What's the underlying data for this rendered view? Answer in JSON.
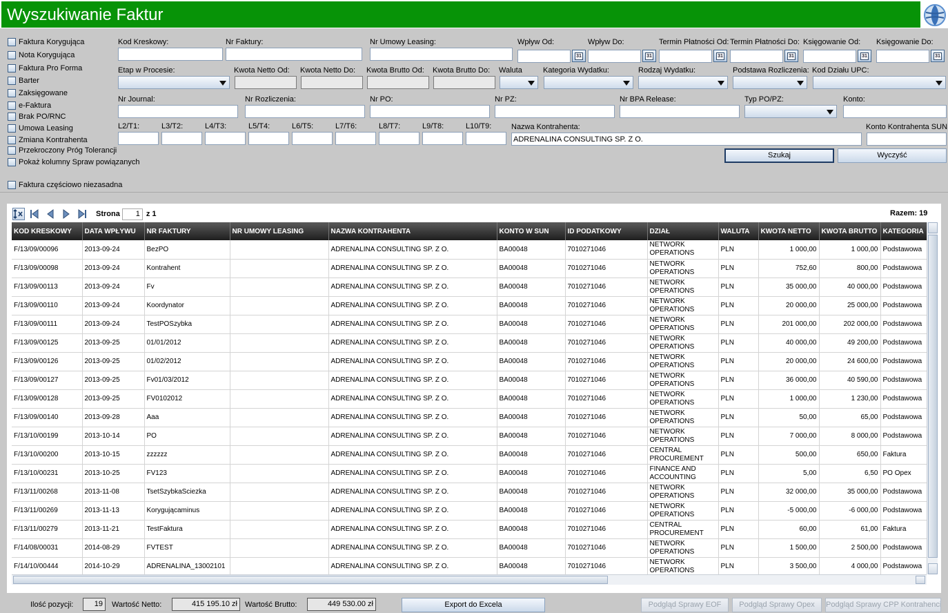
{
  "window": {
    "title": "Wyszukiwanie Faktur"
  },
  "checkboxes": [
    "Faktura Korygująca",
    "Nota Korygująca",
    "Faktura Pro Forma",
    "Barter",
    "Zaksięgowane",
    "e-Faktura",
    "Brak PO/RNC",
    "Umowa Leasing",
    "Zmiana Kontrahenta",
    "Przekroczony Próg Tolerancji",
    "Pokaż kolumny Spraw powiązanych",
    "Faktura częściowo niezasadna"
  ],
  "filters": {
    "kod_kreskowy": "Kod Kreskowy:",
    "nr_faktury": "Nr Faktury:",
    "nr_umowy_leasing": "Nr Umowy Leasing:",
    "wplyw_od": "Wpływ Od:",
    "wplyw_do": "Wpływ Do:",
    "termin_od": "Termin Płatności Od:",
    "termin_do": "Termin Płatności Do:",
    "ksiegowanie_od": "Księgowanie Od:",
    "ksiegowanie_do": "Księgowanie Do:",
    "etap": "Etap w Procesie:",
    "kwota_netto_od": "Kwota Netto Od:",
    "kwota_netto_do": "Kwota Netto Do:",
    "kwota_brutto_od": "Kwota Brutto Od:",
    "kwota_brutto_do": "Kwota Brutto Do:",
    "waluta": "Waluta",
    "kategoria": "Kategoria Wydatku:",
    "rodzaj": "Rodzaj Wydatku:",
    "podstawa": "Podstawa Rozliczenia:",
    "kod_dzialu": "Kod Działu UPC:",
    "nr_journal": "Nr Journal:",
    "nr_rozliczenia": "Nr Rozliczenia:",
    "nr_po": "Nr PO:",
    "nr_pz": "Nr PZ:",
    "nr_bpa": "Nr BPA Release:",
    "typ_po_pz": "Typ PO/PZ:",
    "konto": "Konto:",
    "l2": "L2/T1:",
    "l3": "L3/T2:",
    "l4": "L4/T3:",
    "l5": "L5/T4:",
    "l6": "L6/T5:",
    "l7": "L7/T6:",
    "l8": "L8/T7:",
    "l9": "L9/T8:",
    "l10": "L10/T9:",
    "nazwa_kontrahenta": "Nazwa Kontrahenta:",
    "nazwa_kontrahenta_value": "ADRENALINA CONSULTING SP. Z O.",
    "konto_sun": "Konto Kontrahenta SUN:",
    "cal_icon_text": "31",
    "search_button": "Szukaj",
    "clear_button": "Wyczyść"
  },
  "pager": {
    "strona_label": "Strona",
    "page": "1",
    "of": "z 1",
    "razem": "Razem: 19"
  },
  "table": {
    "columns": [
      "KOD KRESKOWY",
      "DATA WPŁYWU",
      "NR FAKTURY",
      "NR UMOWY LEASING",
      "NAZWA KONTRAHENTA",
      "KONTO W SUN",
      "ID PODATKOWY",
      "DZIAŁ",
      "WALUTA",
      "KWOTA NETTO",
      "KWOTA BRUTTO",
      "KATEGORIA"
    ],
    "rows": [
      [
        "F/13/09/00096",
        "2013-09-24",
        "BezPO",
        "",
        "ADRENALINA CONSULTING SP. Z O.",
        "BA00048",
        "7010271046",
        "NETWORK OPERATIONS",
        "PLN",
        "1 000,00",
        "1 000,00",
        "Podstawowa"
      ],
      [
        "F/13/09/00098",
        "2013-09-24",
        "Kontrahent",
        "",
        "ADRENALINA CONSULTING SP. Z O.",
        "BA00048",
        "7010271046",
        "NETWORK OPERATIONS",
        "PLN",
        "752,60",
        "800,00",
        "Podstawowa"
      ],
      [
        "F/13/09/00113",
        "2013-09-24",
        "Fv",
        "",
        "ADRENALINA CONSULTING SP. Z O.",
        "BA00048",
        "7010271046",
        "NETWORK OPERATIONS",
        "PLN",
        "35 000,00",
        "40 000,00",
        "Podstawowa"
      ],
      [
        "F/13/09/00110",
        "2013-09-24",
        "Koordynator",
        "",
        "ADRENALINA CONSULTING SP. Z O.",
        "BA00048",
        "7010271046",
        "NETWORK OPERATIONS",
        "PLN",
        "20 000,00",
        "25 000,00",
        "Podstawowa"
      ],
      [
        "F/13/09/00111",
        "2013-09-24",
        "TestPOSzybka",
        "",
        "ADRENALINA CONSULTING SP. Z O.",
        "BA00048",
        "7010271046",
        "NETWORK OPERATIONS",
        "PLN",
        "201 000,00",
        "202 000,00",
        "Podstawowa"
      ],
      [
        "F/13/09/00125",
        "2013-09-25",
        "01/01/2012",
        "",
        "ADRENALINA CONSULTING SP. Z O.",
        "BA00048",
        "7010271046",
        "NETWORK OPERATIONS",
        "PLN",
        "40 000,00",
        "49 200,00",
        "Podstawowa"
      ],
      [
        "F/13/09/00126",
        "2013-09-25",
        "01/02/2012",
        "",
        "ADRENALINA CONSULTING SP. Z O.",
        "BA00048",
        "7010271046",
        "NETWORK OPERATIONS",
        "PLN",
        "20 000,00",
        "24 600,00",
        "Podstawowa"
      ],
      [
        "F/13/09/00127",
        "2013-09-25",
        "Fv01/03/2012",
        "",
        "ADRENALINA CONSULTING SP. Z O.",
        "BA00048",
        "7010271046",
        "NETWORK OPERATIONS",
        "PLN",
        "36 000,00",
        "40 590,00",
        "Podstawowa"
      ],
      [
        "F/13/09/00128",
        "2013-09-25",
        "FV0102012",
        "",
        "ADRENALINA CONSULTING SP. Z O.",
        "BA00048",
        "7010271046",
        "NETWORK OPERATIONS",
        "PLN",
        "1 000,00",
        "1 230,00",
        "Podstawowa"
      ],
      [
        "F/13/09/00140",
        "2013-09-28",
        "Aaa",
        "",
        "ADRENALINA CONSULTING SP. Z O.",
        "BA00048",
        "7010271046",
        "NETWORK OPERATIONS",
        "PLN",
        "50,00",
        "65,00",
        "Podstawowa"
      ],
      [
        "F/13/10/00199",
        "2013-10-14",
        "PO",
        "",
        "ADRENALINA CONSULTING SP. Z O.",
        "BA00048",
        "7010271046",
        "NETWORK OPERATIONS",
        "PLN",
        "7 000,00",
        "8 000,00",
        "Podstawowa"
      ],
      [
        "F/13/10/00200",
        "2013-10-15",
        "zzzzzz",
        "",
        "ADRENALINA CONSULTING SP. Z O.",
        "BA00048",
        "7010271046",
        "CENTRAL PROCUREMENT",
        "PLN",
        "500,00",
        "650,00",
        "Faktura"
      ],
      [
        "F/13/10/00231",
        "2013-10-25",
        "FV123",
        "",
        "ADRENALINA CONSULTING SP. Z O.",
        "BA00048",
        "7010271046",
        "FINANCE AND ACCOUNTING",
        "PLN",
        "5,00",
        "6,50",
        "PO Opex"
      ],
      [
        "F/13/11/00268",
        "2013-11-08",
        "TsetSzybkaSciezka",
        "",
        "ADRENALINA CONSULTING SP. Z O.",
        "BA00048",
        "7010271046",
        "NETWORK OPERATIONS",
        "PLN",
        "32 000,00",
        "35 000,00",
        "Podstawowa"
      ],
      [
        "F/13/11/00269",
        "2013-11-13",
        "Korygującaminus",
        "",
        "ADRENALINA CONSULTING SP. Z O.",
        "BA00048",
        "7010271046",
        "NETWORK OPERATIONS",
        "PLN",
        "-5 000,00",
        "-6 000,00",
        "Podstawowa"
      ],
      [
        "F/13/11/00279",
        "2013-11-21",
        "TestFaktura",
        "",
        "ADRENALINA CONSULTING SP. Z O.",
        "BA00048",
        "7010271046",
        "CENTRAL PROCUREMENT",
        "PLN",
        "60,00",
        "61,00",
        "Faktura"
      ],
      [
        "F/14/08/00031",
        "2014-08-29",
        "FVTEST",
        "",
        "ADRENALINA CONSULTING SP. Z O.",
        "BA00048",
        "7010271046",
        "NETWORK OPERATIONS",
        "PLN",
        "1 500,00",
        "2 500,00",
        "Podstawowa"
      ],
      [
        "F/14/10/00444",
        "2014-10-29",
        "ADRENALINA_13002101",
        "",
        "ADRENALINA CONSULTING SP. Z O.",
        "BA00048",
        "7010271046",
        "NETWORK OPERATIONS",
        "PLN",
        "3 500,00",
        "4 000,00",
        "Podstawowa"
      ]
    ]
  },
  "footer": {
    "ilosc_label": "Ilość pozycji:",
    "ilosc_value": "19",
    "netto_label": "Wartość Netto:",
    "netto_value": "415 195.10 zł",
    "brutto_label": "Wartość Brutto:",
    "brutto_value": "449 530.00 zł",
    "export_button": "Export do Excela",
    "eof_button": "Podgląd Sprawy EOF",
    "opex_button": "Podgląd Sprawy Opex",
    "cpp_button": "Podgląd Sprawy CPP Kontrahenci"
  }
}
